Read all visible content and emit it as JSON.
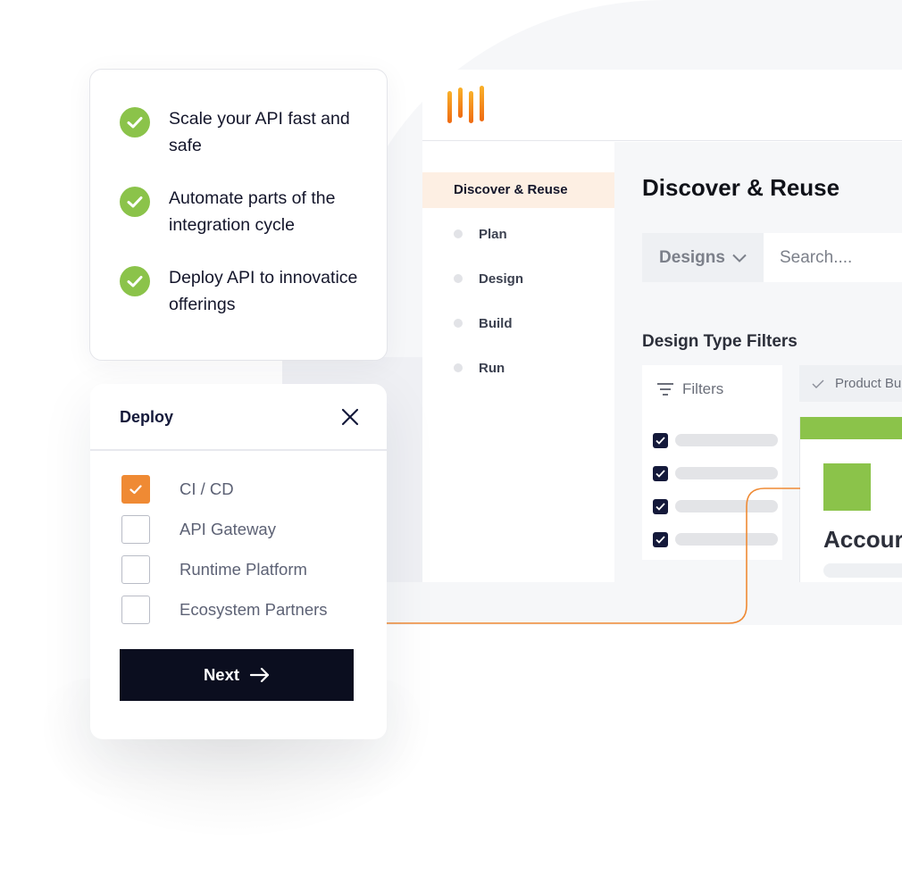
{
  "benefits": {
    "items": [
      {
        "icon": "check-circle-icon",
        "text": "Scale your API fast and safe"
      },
      {
        "icon": "check-circle-icon",
        "text": "Automate parts of the integration cycle"
      },
      {
        "icon": "check-circle-icon",
        "text": "Deploy API to innovatice offerings"
      }
    ]
  },
  "deploy": {
    "title": "Deploy",
    "close_icon": "close-icon",
    "options": [
      {
        "label": "CI / CD",
        "checked": true
      },
      {
        "label": "API Gateway",
        "checked": false
      },
      {
        "label": "Runtime Platform",
        "checked": false
      },
      {
        "label": "Ecosystem Partners",
        "checked": false
      }
    ],
    "next_label": "Next",
    "next_icon": "arrow-right-icon"
  },
  "app": {
    "logo": "bars-logo-icon",
    "sidebar": {
      "active": "Discover & Reuse",
      "items": [
        {
          "label": "Plan"
        },
        {
          "label": "Design"
        },
        {
          "label": "Build"
        },
        {
          "label": "Run"
        }
      ]
    },
    "main": {
      "title": "Discover & Reuse",
      "search": {
        "type_label": "Designs",
        "placeholder": "Search...."
      },
      "filters_section_title": "Design Type Filters",
      "filters_label": "Filters",
      "filter_rows": [
        {
          "checked": true
        },
        {
          "checked": true
        },
        {
          "checked": true
        },
        {
          "checked": true
        }
      ],
      "chip_label": "Product Bu",
      "card_title": "Accour"
    }
  },
  "colors": {
    "accent_orange": "#ef8a34",
    "success_green": "#8bc34a",
    "dark_navy": "#0b0e1f",
    "active_nav_bg": "#fdefe3"
  }
}
